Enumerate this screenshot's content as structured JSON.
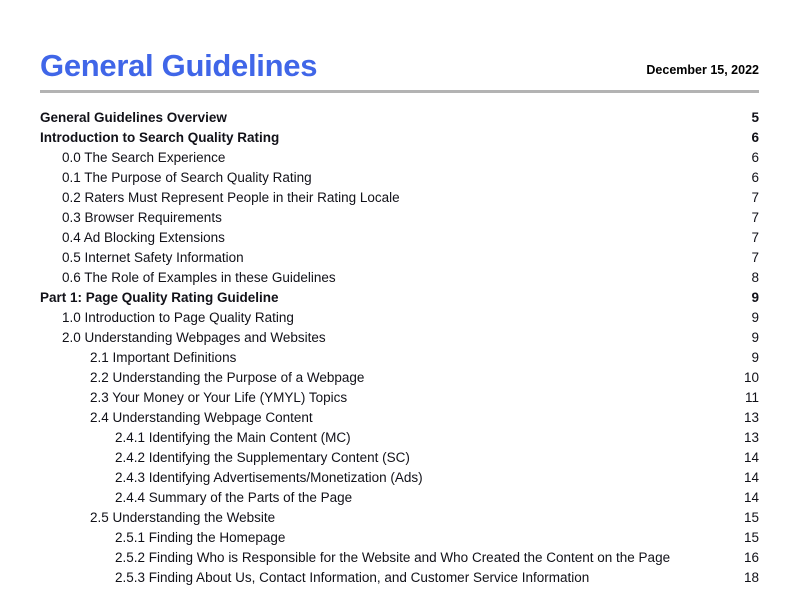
{
  "document": {
    "title": "General Guidelines",
    "date": "December 15, 2022",
    "title_color": "#4066e8",
    "rule_color": "#b3b3b3",
    "text_color": "#111118"
  },
  "toc": {
    "entries": [
      {
        "label": "General Guidelines Overview",
        "page": "5",
        "level": 0,
        "bold": true
      },
      {
        "label": "Introduction to Search Quality Rating",
        "page": "6",
        "level": 0,
        "bold": true
      },
      {
        "label": "0.0 The Search Experience",
        "page": "6",
        "level": 1,
        "bold": false
      },
      {
        "label": "0.1 The Purpose of Search Quality Rating",
        "page": "6",
        "level": 1,
        "bold": false
      },
      {
        "label": "0.2 Raters Must Represent People in their Rating Locale",
        "page": "7",
        "level": 1,
        "bold": false
      },
      {
        "label": "0.3 Browser Requirements",
        "page": "7",
        "level": 1,
        "bold": false
      },
      {
        "label": "0.4 Ad Blocking Extensions",
        "page": "7",
        "level": 1,
        "bold": false
      },
      {
        "label": "0.5 Internet Safety Information",
        "page": "7",
        "level": 1,
        "bold": false
      },
      {
        "label": "0.6 The Role of Examples in these Guidelines",
        "page": "8",
        "level": 1,
        "bold": false
      },
      {
        "label": "Part 1: Page Quality Rating Guideline",
        "page": "9",
        "level": 0,
        "bold": true
      },
      {
        "label": "1.0 Introduction to Page Quality Rating",
        "page": "9",
        "level": 1,
        "bold": false
      },
      {
        "label": "2.0 Understanding Webpages and Websites",
        "page": "9",
        "level": 1,
        "bold": false
      },
      {
        "label": "2.1 Important Definitions",
        "page": "9",
        "level": 2,
        "bold": false
      },
      {
        "label": "2.2 Understanding the Purpose of a Webpage",
        "page": "10",
        "level": 2,
        "bold": false
      },
      {
        "label": "2.3 Your Money or Your Life (YMYL) Topics",
        "page": "11",
        "level": 2,
        "bold": false
      },
      {
        "label": "2.4 Understanding Webpage Content",
        "page": "13",
        "level": 2,
        "bold": false
      },
      {
        "label": "2.4.1 Identifying the Main Content (MC)",
        "page": "13",
        "level": 3,
        "bold": false
      },
      {
        "label": "2.4.2 Identifying the Supplementary Content (SC)",
        "page": "14",
        "level": 3,
        "bold": false
      },
      {
        "label": "2.4.3 Identifying Advertisements/Monetization (Ads)",
        "page": "14",
        "level": 3,
        "bold": false
      },
      {
        "label": "2.4.4 Summary of the Parts of the Page",
        "page": "14",
        "level": 3,
        "bold": false
      },
      {
        "label": "2.5 Understanding the Website",
        "page": "15",
        "level": 2,
        "bold": false
      },
      {
        "label": "2.5.1 Finding the Homepage",
        "page": "15",
        "level": 3,
        "bold": false
      },
      {
        "label": "2.5.2 Finding Who is Responsible for the Website and Who Created the Content on the Page",
        "page": "16",
        "level": 3,
        "bold": false
      },
      {
        "label": "2.5.3 Finding About Us, Contact Information, and Customer Service Information",
        "page": "18",
        "level": 3,
        "bold": false
      }
    ]
  }
}
